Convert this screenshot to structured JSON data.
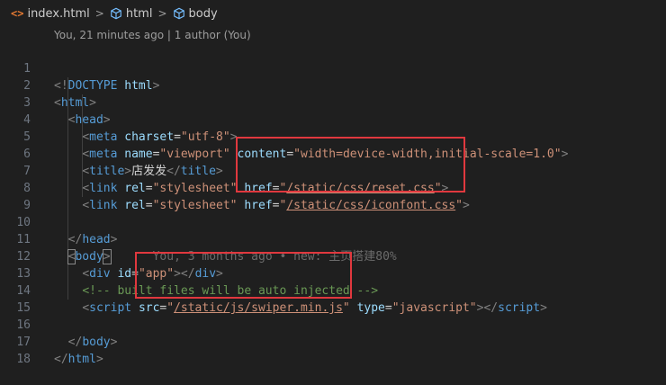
{
  "breadcrumb": {
    "file": "index.html",
    "items": [
      "html",
      "body"
    ]
  },
  "blame_header": "You, 21 minutes ago | 1 author (You)",
  "line_numbers": [
    "1",
    "2",
    "3",
    "4",
    "5",
    "6",
    "7",
    "8",
    "9",
    "10",
    "11",
    "12",
    "13",
    "14",
    "15",
    "16",
    "17",
    "18"
  ],
  "code": {
    "l1": {
      "open": "<!",
      "kw": "DOCTYPE",
      "name": " html",
      "close": ">"
    },
    "l2": {
      "tag": "html"
    },
    "l3": {
      "tag": "head"
    },
    "l4": {
      "tag": "meta",
      "attr1": "charset",
      "val1": "\"utf-8\""
    },
    "l5": {
      "tag": "meta",
      "attr1": "name",
      "val1": "\"viewport\"",
      "attr2": "content",
      "val2": "\"width=device-width,initial-scale=1.0\""
    },
    "l6": {
      "tag": "title",
      "text": "店发发"
    },
    "l7": {
      "tag": "link",
      "attr1": "rel",
      "val1": "\"stylesheet\"",
      "attr2": "href",
      "q": "\"",
      "path": "/static/css/reset.css"
    },
    "l8": {
      "tag": "link",
      "attr1": "rel",
      "val1": "\"stylesheet\"",
      "attr2": "href",
      "q": "\"",
      "path": "/static/css/iconfont.css"
    },
    "l10": {
      "tag": "head"
    },
    "l11": {
      "tag": "body",
      "blame": "You, 3 months ago • new: 主页搭建80%"
    },
    "l12": {
      "tag": "div",
      "attr1": "id",
      "val1": "\"app\""
    },
    "l13": {
      "comment": "<!-- built files will be auto injected -->"
    },
    "l14": {
      "tag": "script",
      "attr1": "src",
      "q": "\"",
      "path": "/static/js/swiper.min.js",
      "attr2": "type",
      "val2": "\"javascript\""
    },
    "l16": {
      "tag": "body"
    },
    "l17": {
      "tag": "html"
    }
  },
  "colors": {
    "background": "#1f1f1f",
    "tag": "#569cd6",
    "attribute": "#9cdcfe",
    "string": "#ce9178",
    "comment": "#6a9955",
    "highlight_box": "#e0383e"
  }
}
